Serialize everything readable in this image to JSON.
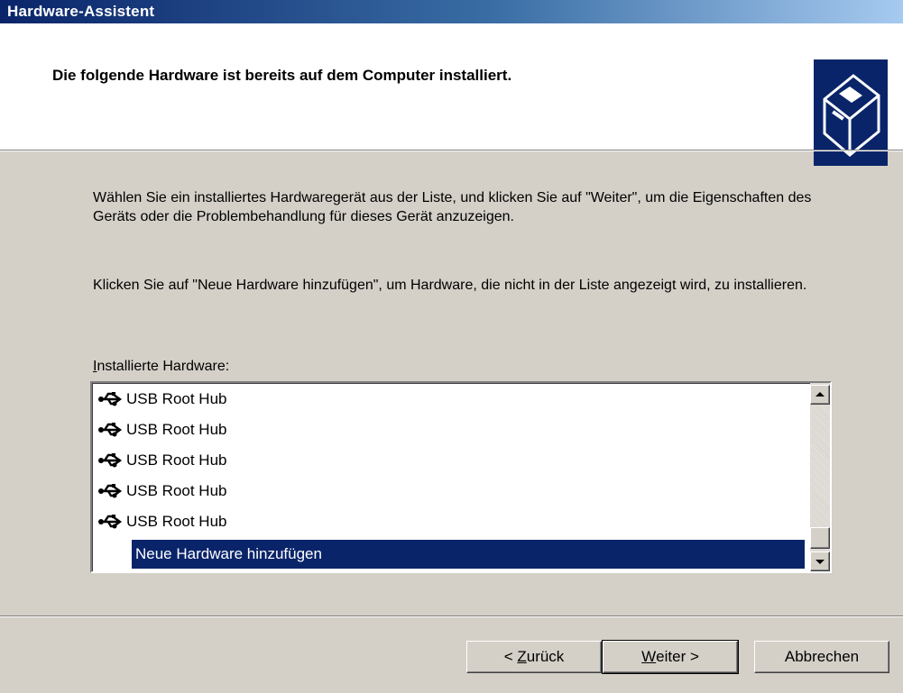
{
  "window": {
    "title": "Hardware-Assistent"
  },
  "header": {
    "heading": "Die folgende Hardware ist bereits auf dem Computer installiert."
  },
  "body": {
    "para1": "Wählen Sie ein installiertes Hardwaregerät aus der Liste, und klicken Sie auf \"Weiter\", um die Eigenschaften des Geräts oder die Problembehandlung für dieses Gerät anzuzeigen.",
    "para2": "Klicken Sie auf \"Neue Hardware hinzufügen\", um Hardware, die nicht in der Liste angezeigt wird, zu installieren.",
    "list_label_first": "I",
    "list_label_rest": "nstallierte Hardware:"
  },
  "list": {
    "items": [
      {
        "label": "USB Root Hub",
        "icon": "usb-icon"
      },
      {
        "label": "USB Root Hub",
        "icon": "usb-icon"
      },
      {
        "label": "USB Root Hub",
        "icon": "usb-icon"
      },
      {
        "label": "USB Root Hub",
        "icon": "usb-icon"
      },
      {
        "label": "USB Root Hub",
        "icon": "usb-icon"
      }
    ],
    "selected_item": "Neue Hardware hinzufügen"
  },
  "buttons": {
    "back_prefix": "< ",
    "back_accel": "Z",
    "back_rest": "urück",
    "next_accel": "W",
    "next_rest": "eiter >",
    "cancel": "Abbrechen"
  },
  "colors": {
    "title_bar": "#0a246a",
    "selection": "#0a246a",
    "dialog_bg": "#d4d0c8"
  }
}
